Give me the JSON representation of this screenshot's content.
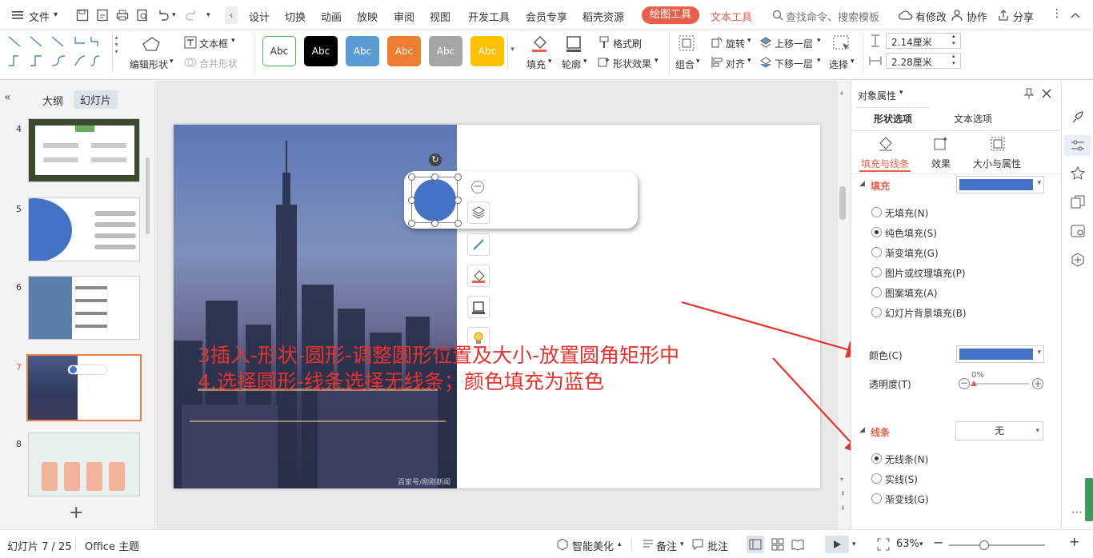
{
  "menu": {
    "file_label": "文件",
    "tabs": [
      "设计",
      "切换",
      "动画",
      "放映",
      "审阅",
      "视图",
      "开发工具",
      "会员专享",
      "稻壳资源"
    ],
    "drawing_tools_tab": "绘图工具",
    "text_tools_tab": "文本工具",
    "search_placeholder": "查找命令、搜索模板",
    "has_changes_label": "有修改",
    "collab_label": "协作",
    "share_label": "分享"
  },
  "ribbon": {
    "edit_shape_label": "编辑形状",
    "textbox_label": "文本框",
    "merge_shape_label": "合并形状",
    "style_swatches": [
      {
        "label": "Abc",
        "bg": "#ffffff",
        "fg": "#333333",
        "border": "#5aad5a"
      },
      {
        "label": "Abc",
        "bg": "#000000",
        "fg": "#ffffff",
        "border": "#000000"
      },
      {
        "label": "Abc",
        "bg": "#5b9bd5",
        "fg": "#ffffff",
        "border": "#5b9bd5"
      },
      {
        "label": "Abc",
        "bg": "#ed7d31",
        "fg": "#ffffff",
        "border": "#ed7d31"
      },
      {
        "label": "Abc",
        "bg": "#a5a5a5",
        "fg": "#ffffff",
        "border": "#a5a5a5"
      },
      {
        "label": "Abc",
        "bg": "#ffc000",
        "fg": "#ffffff",
        "border": "#ffc000"
      }
    ],
    "fill_label": "填充",
    "outline_label": "轮廓",
    "format_painter_label": "格式刷",
    "shape_effect_label": "形状效果",
    "group_label": "组合",
    "rotate_label": "旋转",
    "align_label": "对齐",
    "bring_forward_label": "上移一层",
    "send_backward_label": "下移一层",
    "select_label": "选择",
    "height_value": "2.14厘米",
    "width_value": "2.28厘米"
  },
  "left_panel": {
    "outline_tab": "大纲",
    "slides_tab": "幻灯片",
    "slide_numbers": [
      "4",
      "5",
      "6",
      "7",
      "8"
    ],
    "selected_slide": "7"
  },
  "slide": {
    "annotation_line1": "3插入-形状-圆形-调整圆形位置及大小-放置圆角矩形中",
    "annotation_line2": "4.选择圆形-线条选择无线条；颜色填充为蓝色",
    "watermark": "百家号/刚刚新闻",
    "circle_color": "#4472c4",
    "annotation_color": "#e8322d"
  },
  "right_panel": {
    "title": "对象属性",
    "tab_shape": "形状选项",
    "tab_text": "文本选项",
    "sub_fill_line": "填充与线条",
    "sub_effect": "效果",
    "sub_size": "大小与属性",
    "fill_section": "填充",
    "fill_options": [
      "无填充(N)",
      "纯色填充(S)",
      "渐变填充(G)",
      "图片或纹理填充(P)",
      "图案填充(A)",
      "幻灯片背景填充(B)"
    ],
    "fill_selected_index": 1,
    "color_label": "颜色(C)",
    "fill_color": "#4472c4",
    "transparency_label": "透明度(T)",
    "transparency_value": "0%",
    "line_section": "线条",
    "line_dropdown_value": "无",
    "line_options": [
      "无线条(N)",
      "实线(S)",
      "渐变线(G)"
    ],
    "line_selected_index": 0
  },
  "status": {
    "slide_counter": "幻灯片 7 / 25",
    "theme": "Office 主题",
    "smart_beautify": "智能美化",
    "notes": "备注",
    "comments": "批注",
    "zoom": "63%"
  }
}
